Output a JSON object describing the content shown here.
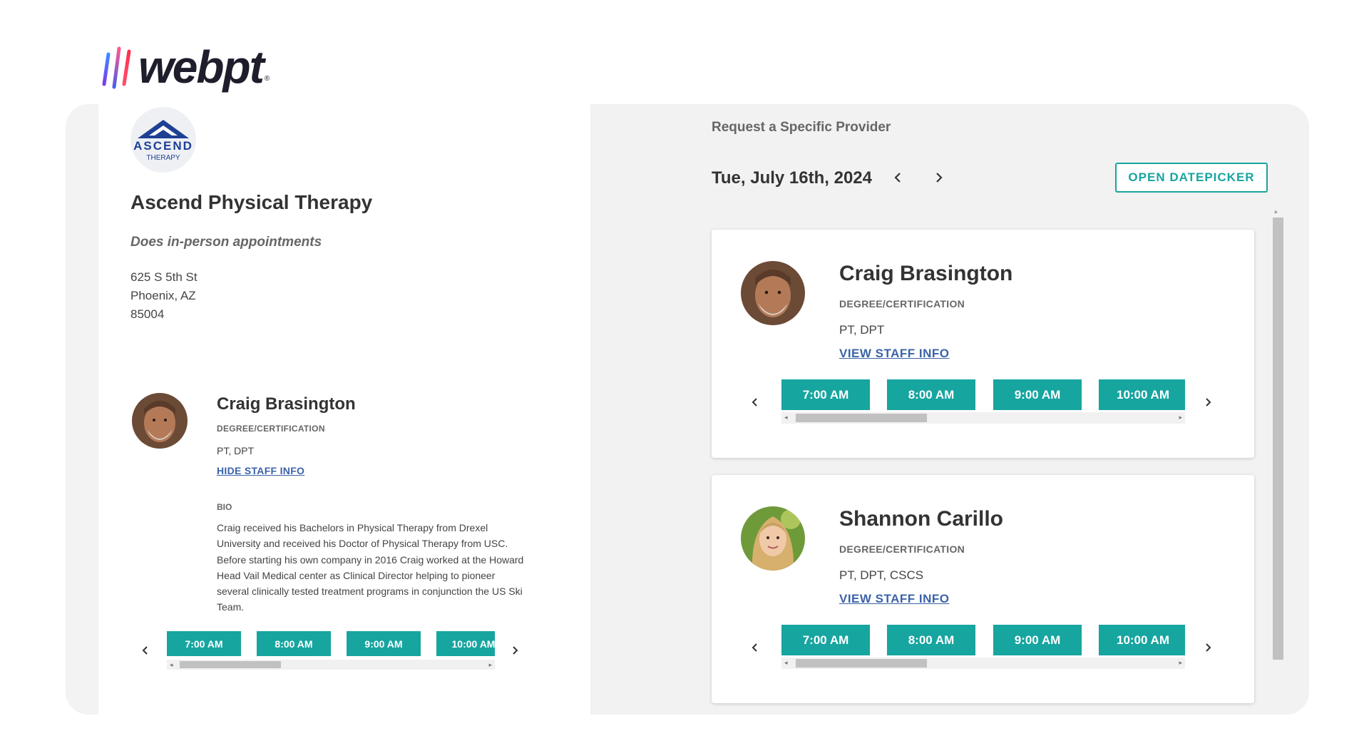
{
  "brand": {
    "name": "webpt",
    "reg": "®"
  },
  "clinic": {
    "logo_text": "ASCEND",
    "logo_sub": "THERAPY",
    "name": "Ascend Physical Therapy",
    "appointment_type": "Does in-person appointments",
    "address": [
      "625 S 5th St",
      "Phoenix, AZ",
      "85004"
    ]
  },
  "selected_provider": {
    "name": "Craig Brasington",
    "degree_label": "DEGREE/CERTIFICATION",
    "credentials": "PT, DPT",
    "toggle_link": "HIDE STAFF INFO",
    "bio_label": "BIO",
    "bio": "Craig received his Bachelors in Physical Therapy from Drexel University and received his Doctor of Physical Therapy from USC. Before starting his own company in 2016 Craig worked at the Howard Head Vail Medical center as Clinical Director helping to pioneer several clinically tested treatment programs in conjunction the US Ski Team.",
    "slots": [
      "7:00 AM",
      "8:00 AM",
      "9:00 AM",
      "10:00 AM"
    ]
  },
  "request": {
    "title": "Request a Specific Provider",
    "date": "Tue, July 16th, 2024",
    "datepicker_button": "OPEN DATEPICKER"
  },
  "providers": [
    {
      "name": "Craig Brasington",
      "degree_label": "DEGREE/CERTIFICATION",
      "credentials": "PT, DPT",
      "link": "VIEW STAFF INFO",
      "slots": [
        "7:00 AM",
        "8:00 AM",
        "9:00 AM",
        "10:00 AM"
      ]
    },
    {
      "name": "Shannon Carillo",
      "degree_label": "DEGREE/CERTIFICATION",
      "credentials": "PT, DPT, CSCS",
      "link": "VIEW STAFF INFO",
      "slots": [
        "7:00 AM",
        "8:00 AM",
        "9:00 AM",
        "10:00 AM"
      ]
    }
  ],
  "colors": {
    "accent": "#17a5a0",
    "link": "#3b63a8",
    "panel": "#f2f2f2"
  }
}
